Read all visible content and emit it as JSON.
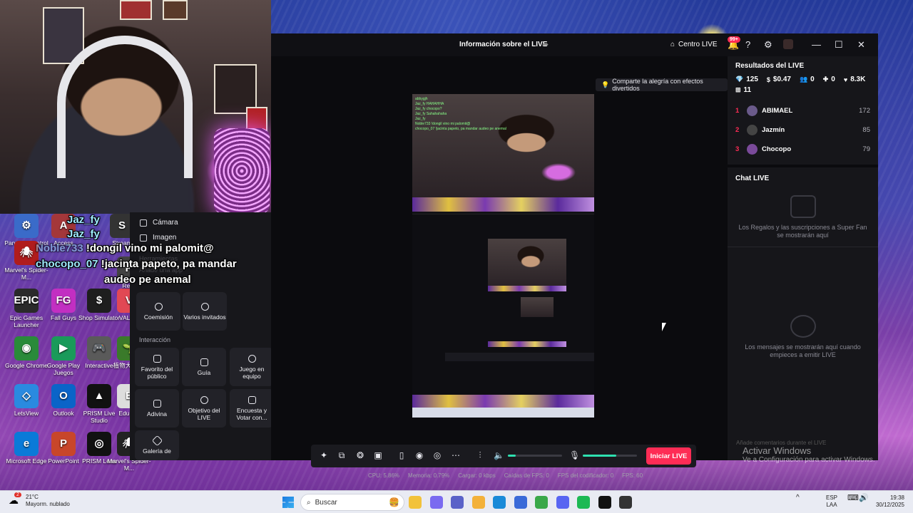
{
  "desktop": {
    "icons": [
      {
        "label": "Panel de control",
        "glyph": "⚙",
        "color": "#3a6bc9"
      },
      {
        "label": "Access",
        "glyph": "A",
        "color": "#a4373a"
      },
      {
        "label": "Marvel's Spider-M...",
        "glyph": "🕷",
        "color": "#b01c1c"
      },
      {
        "label": "Epic Games Launcher",
        "glyph": "EPIC",
        "color": "#2a2a2a"
      },
      {
        "label": "Fall Guys",
        "glyph": "FG",
        "color": "#c22fc2"
      },
      {
        "label": "Shop Simulator",
        "glyph": "$",
        "color": "#1e1e1e"
      },
      {
        "label": "VALOR",
        "glyph": "V",
        "color": "#e14854"
      },
      {
        "label": "Google Chrome",
        "glyph": "◉",
        "color": "#2a8a3a"
      },
      {
        "label": "Google Play Juegos",
        "glyph": "▶",
        "color": "#1a9a5a"
      },
      {
        "label": "Interactive",
        "glyph": "🎮",
        "color": "#5a5a5a"
      },
      {
        "label": "植物大 尸突",
        "glyph": "🌱",
        "color": "#3a7a2a"
      },
      {
        "label": "LetsView",
        "glyph": "◇",
        "color": "#2a8ae0"
      },
      {
        "label": "Outlook",
        "glyph": "O",
        "color": "#0a64c8"
      },
      {
        "label": "PRISM Live Studio",
        "glyph": "▲",
        "color": "#111"
      },
      {
        "label": "EduGar",
        "glyph": "E",
        "color": "#ddd"
      },
      {
        "label": "Microsoft Edge",
        "glyph": "e",
        "color": "#0a7ad8"
      },
      {
        "label": "PowerPoint",
        "glyph": "P",
        "color": "#c8462a"
      },
      {
        "label": "PRISM Lens",
        "glyph": "◎",
        "color": "#111"
      },
      {
        "label": "Marvel's Spider-M...",
        "glyph": "🕷",
        "color": "#222"
      },
      {
        "label": "Stream",
        "glyph": "S",
        "color": "#333"
      },
      {
        "label": "Resc",
        "glyph": "R",
        "color": "#444"
      }
    ]
  },
  "overlay_chat": [
    {
      "user": "Jaz_fy",
      "text": ""
    },
    {
      "user": "Jaz_fy",
      "text": ""
    },
    {
      "user": "Noble733",
      "text": "!dongil vino mi palomit@"
    },
    {
      "user": "chocopo_07",
      "text": "!jacinta papeto, pa mandar"
    },
    {
      "user": "",
      "text": "audeo pe anemal"
    }
  ],
  "sources_panel": {
    "items": [
      {
        "label": "Cámara"
      },
      {
        "label": "Imagen"
      }
    ],
    "hidden_labels": [
      "Herramientas",
      "Añade una app"
    ],
    "tools": [
      {
        "label": "Coemisión",
        "icon": "link-icon"
      },
      {
        "label": "Varios invitados",
        "icon": "users-icon"
      }
    ],
    "interaction_title": "Interacción",
    "interaction": [
      {
        "label": "Favorito del público",
        "icon": "fav-icon"
      },
      {
        "label": "Guía",
        "icon": "book-icon"
      },
      {
        "label": "Juego en equipo",
        "icon": "team-icon"
      },
      {
        "label": "Adivina",
        "icon": "guess-icon"
      },
      {
        "label": "Objetivo del LIVE",
        "icon": "target-icon"
      },
      {
        "label": "Encuesta y Votar con...",
        "icon": "poll-icon"
      },
      {
        "label": "Galería de",
        "icon": "gallery-icon"
      }
    ]
  },
  "app": {
    "title": "Información sobre el LIVE",
    "centro_live": "Centro LIVE",
    "notifications_badge": "99+",
    "tip": "Comparte la alegría con efectos divertidos",
    "preview_chat": [
      "abbygjh",
      "Jaz_fy HAHAHHA",
      "Jaz_fy chocopo?",
      "Jaz_fy Sahahahaha",
      "Jaz_fy ",
      "Noble733 !dongil vino mi palomit@",
      "chocopo_07 !jacinta papeto, pa mandar audeo pe anemal"
    ],
    "go_live_label": "Iniciar LIVE",
    "mic_level": 0.62,
    "speaker_level": 0.15,
    "stats": [
      {
        "label": "CPU:",
        "value": "5.86%"
      },
      {
        "label": "Memoria:",
        "value": "0.79%"
      },
      {
        "label": "Cargar:",
        "value": "0 kbps"
      },
      {
        "label": "Caídas de FPS:",
        "value": "0"
      },
      {
        "label": "FPS del codificador:",
        "value": "0"
      },
      {
        "label": "FPS:",
        "value": "60"
      }
    ]
  },
  "results": {
    "title": "Resultados del LIVE",
    "metrics": [
      {
        "icon": "diamond-icon",
        "glyph": "💎",
        "value": "125"
      },
      {
        "icon": "coin-icon",
        "glyph": "$",
        "value": "$0.47"
      },
      {
        "icon": "viewers-icon",
        "glyph": "👥",
        "value": "0"
      },
      {
        "icon": "new-followers-icon",
        "glyph": "✚",
        "value": "0"
      },
      {
        "icon": "likes-icon",
        "glyph": "♥",
        "value": "8.3K"
      },
      {
        "icon": "shares-icon",
        "glyph": "⊞",
        "value": "11"
      }
    ],
    "ranking": [
      {
        "pos": "1",
        "name": "ABIMAEL",
        "score": "172",
        "avatar": "#6a5a8a"
      },
      {
        "pos": "2",
        "name": "Jazmín",
        "score": "85",
        "avatar": "#444"
      },
      {
        "pos": "3",
        "name": "Chocopo",
        "score": "79",
        "avatar": "#7a4a9a"
      }
    ]
  },
  "chat": {
    "title": "Chat LIVE",
    "gifts_note": "Los Regalos y las suscripciones a Super Fan se mostrarán aquí",
    "messages_note": "Los mensajes se mostrarán aquí cuando empieces a emitir LIVE",
    "input_placeholder": "Añade comentarios durante el LIVE"
  },
  "windows_activation": {
    "heading": "Activar Windows",
    "sub": "Ve a Configuración para activar Windows."
  },
  "taskbar": {
    "weather_temp": "21°C",
    "weather_desc": "Mayorm. nublado",
    "weather_badge": "2",
    "search_placeholder": "Buscar",
    "apps": [
      {
        "name": "file-explorer",
        "color": "#f2c23a"
      },
      {
        "name": "copilot",
        "color": "#7a6af0"
      },
      {
        "name": "teams",
        "color": "#5a62c8"
      },
      {
        "name": "folder",
        "color": "#f3b13a"
      },
      {
        "name": "edge",
        "color": "#1a8ad8"
      },
      {
        "name": "store",
        "color": "#3a6ad8"
      },
      {
        "name": "chrome",
        "color": "#3aa84a"
      },
      {
        "name": "discord",
        "color": "#5865f2"
      },
      {
        "name": "spotify",
        "color": "#1db954"
      },
      {
        "name": "tiktok-live",
        "color": "#111"
      },
      {
        "name": "obs",
        "color": "#333"
      }
    ],
    "lang": "ESP",
    "lang_sub": "LAA",
    "time": "19:38",
    "date": "30/12/2025"
  }
}
